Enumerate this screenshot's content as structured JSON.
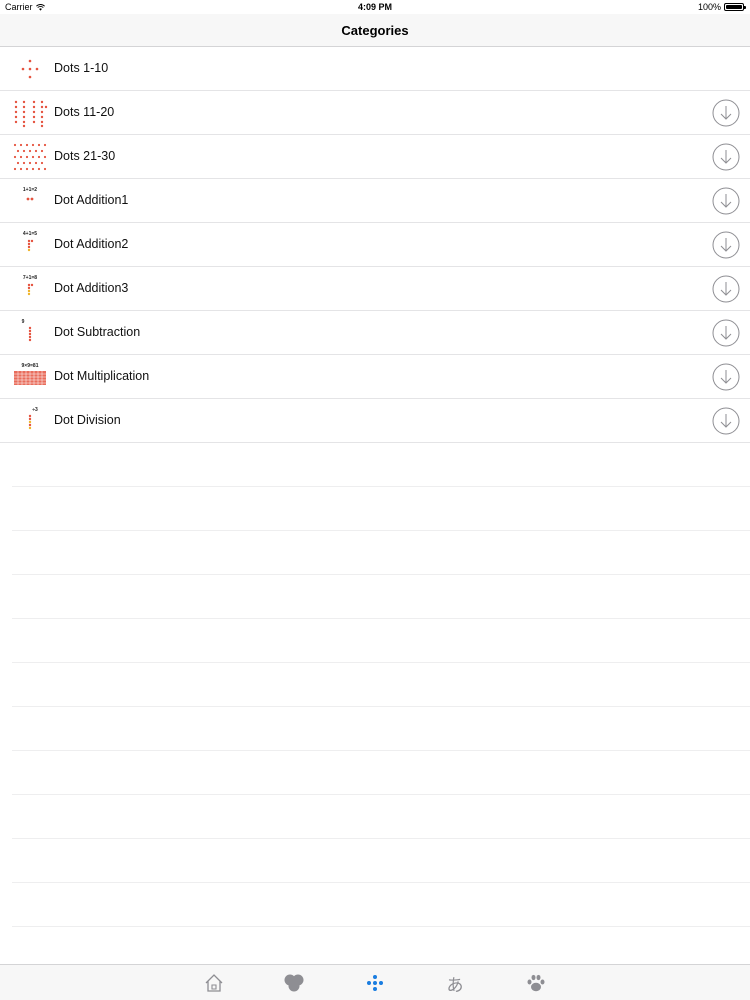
{
  "status_bar": {
    "carrier": "Carrier",
    "time": "4:09 PM",
    "battery": "100%"
  },
  "nav": {
    "title": "Categories"
  },
  "categories": [
    {
      "label": "Dots 1-10",
      "thumb_caption": "",
      "downloadable": false
    },
    {
      "label": "Dots 11-20",
      "thumb_caption": "",
      "downloadable": true
    },
    {
      "label": "Dots 21-30",
      "thumb_caption": "",
      "downloadable": true
    },
    {
      "label": "Dot Addition1",
      "thumb_caption": "1+1=2",
      "downloadable": true
    },
    {
      "label": "Dot Addition2",
      "thumb_caption": "4+1=5",
      "downloadable": true
    },
    {
      "label": "Dot Addition3",
      "thumb_caption": "7+1=8",
      "downloadable": true
    },
    {
      "label": "Dot Subtraction",
      "thumb_caption": "9",
      "downloadable": true
    },
    {
      "label": "Dot Multiplication",
      "thumb_caption": "9×9=81",
      "downloadable": true
    },
    {
      "label": "Dot Division",
      "thumb_caption": "÷3",
      "downloadable": true
    }
  ],
  "tab_bar": {
    "items": [
      {
        "name": "home",
        "icon": "house-icon",
        "selected": false
      },
      {
        "name": "shapes",
        "icon": "clover-icon",
        "selected": false
      },
      {
        "name": "dots",
        "icon": "dots-icon",
        "selected": true
      },
      {
        "name": "hiragana",
        "icon": "hiragana-icon",
        "glyph": "あ",
        "selected": false
      },
      {
        "name": "animals",
        "icon": "paw-icon",
        "selected": false
      }
    ]
  },
  "colors": {
    "accent": "#1a7de0",
    "dot_red": "#e5533f",
    "dot_yellow": "#f0b429",
    "icon_gray": "#8e8e93"
  }
}
